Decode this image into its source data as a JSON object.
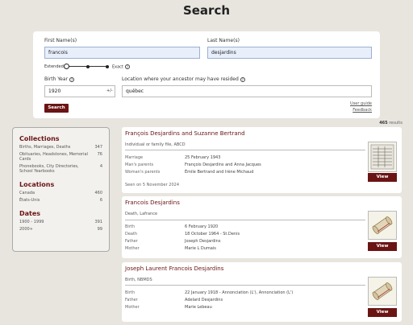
{
  "page": {
    "title": "Search"
  },
  "search": {
    "first_name_label": "First Name(s)",
    "first_name_value": "francois",
    "last_name_label": "Last Name(s)",
    "last_name_value": "desjardins",
    "extended_label": "Extended",
    "exact_label": "Exact",
    "birth_year_label": "Birth Year",
    "birth_year_value": "1920",
    "tolerance_label": "+/-",
    "location_label": "Location where your ancestor may have resided",
    "location_value": "québec",
    "search_button": "Search",
    "user_guide": "User guide",
    "feedback": "Feedback"
  },
  "results": {
    "count": "465",
    "count_suffix": "results"
  },
  "filters": {
    "collections_title": "Collections",
    "collections": [
      {
        "label": "Births, Marriages, Deaths",
        "count": "347"
      },
      {
        "label": "Obituaries, Headstones, Memorial Cards",
        "count": "76"
      },
      {
        "label": "Phonebooks, City Directories, School Yearbooks",
        "count": "4"
      }
    ],
    "locations_title": "Locations",
    "locations": [
      {
        "label": "Canada",
        "count": "460"
      },
      {
        "label": "États-Unis",
        "count": "6"
      }
    ],
    "dates_title": "Dates",
    "dates": [
      {
        "label": "1900 - 1999",
        "count": "391"
      },
      {
        "label": "2000+",
        "count": "99"
      }
    ]
  },
  "cards": [
    {
      "title": "François Desjardins and Suzanne Bertrand",
      "subtitle": "Individual or family file, ABCD",
      "rows": [
        {
          "label": "Marriage",
          "value": "25 February 1943"
        },
        {
          "label": "Man's parents",
          "value": "François Desjardins and Anna Jacques"
        },
        {
          "label": "Woman's parents",
          "value": "Émile Bertrand and Irène Michaud"
        }
      ],
      "seen": "Seen on 5 November 2024",
      "view": "View"
    },
    {
      "title": "Francois Desjardins",
      "subtitle": "Death, Lafrance",
      "rows": [
        {
          "label": "Birth",
          "value": "6 February 1920"
        },
        {
          "label": "Death",
          "value": "18 October 1964 - St.Denis"
        },
        {
          "label": "Father",
          "value": "Joseph Desjardins"
        },
        {
          "label": "Mother",
          "value": "Marie L Dumais"
        }
      ],
      "view": "View"
    },
    {
      "title": "Joseph Laurent Francois Desjardins",
      "subtitle": "Birth, NBMDS",
      "rows": [
        {
          "label": "Birth",
          "value": "22 January 1918 - Annonciation (L'), Annonciation (L')"
        },
        {
          "label": "Father",
          "value": "Adelard Desjardins"
        },
        {
          "label": "Mother",
          "value": "Marie Lebeau"
        }
      ],
      "view": "View"
    }
  ]
}
